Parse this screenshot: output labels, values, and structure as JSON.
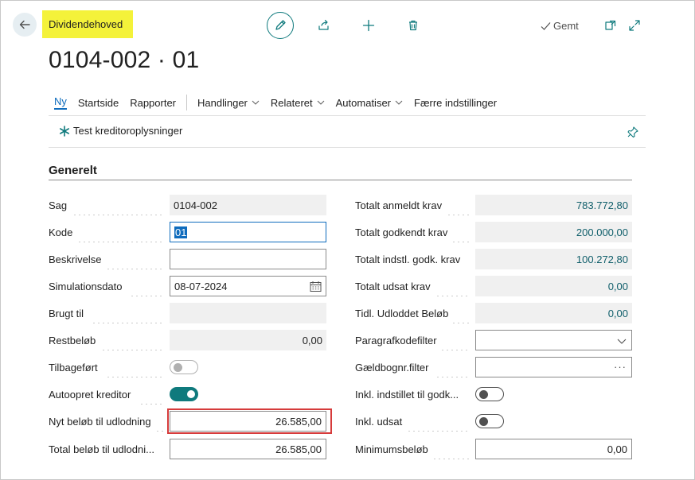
{
  "header": {
    "caption": "Dividendehoved",
    "saved_status": "Gemt",
    "title": "0104-002 · 01"
  },
  "action_bar": {
    "items": [
      {
        "label": "Ny",
        "active": true
      },
      {
        "label": "Startside"
      },
      {
        "label": "Rapporter"
      },
      {
        "label": "Handlinger"
      },
      {
        "label": "Relateret"
      },
      {
        "label": "Automatiser"
      },
      {
        "label": "Færre indstillinger"
      }
    ],
    "promoted_action": "Test kreditoroplysninger"
  },
  "group": {
    "title": "Generelt"
  },
  "left_fields": {
    "sag": {
      "label": "Sag",
      "value": "0104-002"
    },
    "kode": {
      "label": "Kode",
      "value": "01"
    },
    "beskrivelse": {
      "label": "Beskrivelse",
      "value": ""
    },
    "simulationsdato": {
      "label": "Simulationsdato",
      "value": "08-07-2024"
    },
    "brugt_til": {
      "label": "Brugt til",
      "value": ""
    },
    "restbeloeb": {
      "label": "Restbeløb",
      "value": "0,00"
    },
    "tilbagefoert": {
      "label": "Tilbageført",
      "on": false
    },
    "autoopret": {
      "label": "Autoopret kreditor",
      "on": true
    },
    "nyt_beloeb": {
      "label": "Nyt beløb til udlodning",
      "value": "26.585,00"
    },
    "total_beloeb": {
      "label": "Total beløb til udlodni...",
      "value": "26.585,00"
    }
  },
  "right_fields": {
    "totalt_anmeldt": {
      "label": "Totalt anmeldt krav",
      "value": "783.772,80"
    },
    "totalt_godkendt": {
      "label": "Totalt godkendt krav",
      "value": "200.000,00"
    },
    "totalt_indstl": {
      "label": "Totalt indstl. godk. krav",
      "value": "100.272,80"
    },
    "totalt_udsat": {
      "label": "Totalt udsat krav",
      "value": "0,00"
    },
    "tidl_udloddet": {
      "label": "Tidl. Udloddet Beløb",
      "value": "0,00"
    },
    "paragrafkodefilter": {
      "label": "Paragrafkodefilter",
      "value": ""
    },
    "gaeldbognr": {
      "label": "Gældbognr.filter",
      "value": ""
    },
    "inkl_indstillet": {
      "label": "Inkl. indstillet til godk...",
      "on": false
    },
    "inkl_udsat": {
      "label": "Inkl. udsat",
      "on": false
    },
    "minimumsbeloeb": {
      "label": "Minimumsbeløb",
      "value": "0,00"
    }
  },
  "colors": {
    "accent": "#0f7a7d",
    "link": "#0f6cbd",
    "caption_highlight": "#f4f23a",
    "annotation_red": "#d63b3b"
  }
}
